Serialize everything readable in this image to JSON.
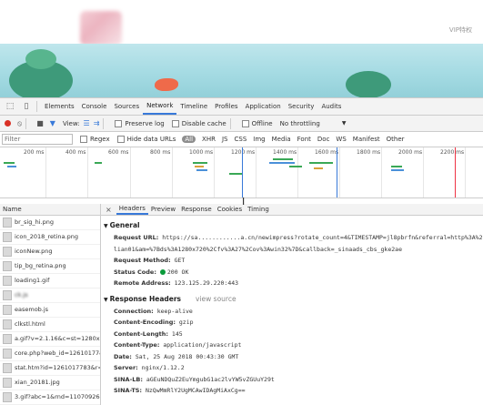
{
  "page": {
    "vip_link": "VIP特权"
  },
  "devtools": {
    "tabs": [
      "Elements",
      "Console",
      "Sources",
      "Network",
      "Timeline",
      "Profiles",
      "Application",
      "Security",
      "Audits"
    ],
    "active_tab": "Network",
    "toolbar": {
      "view_label": "View:",
      "preserve_log": "Preserve log",
      "disable_cache": "Disable cache",
      "offline": "Offline",
      "throttling": "No throttling"
    },
    "filterbar": {
      "filter_placeholder": "Filter",
      "regex": "Regex",
      "hide_data_urls": "Hide data URLs",
      "types": [
        "All",
        "XHR",
        "JS",
        "CSS",
        "Img",
        "Media",
        "Font",
        "Doc",
        "WS",
        "Manifest",
        "Other"
      ],
      "active_type": "All"
    },
    "timeline": {
      "ticks": [
        "200 ms",
        "400 ms",
        "600 ms",
        "800 ms",
        "1000 ms",
        "1200 ms",
        "1400 ms",
        "1600 ms",
        "1800 ms",
        "2000 ms",
        "2200 ms"
      ]
    },
    "requests": {
      "header": "Name",
      "items": [
        {
          "name": "br_sig_hi.png",
          "blur": false
        },
        {
          "name": "icon_2018_retina.png",
          "blur": false
        },
        {
          "name": "iconNew.png",
          "blur": false
        },
        {
          "name": "tip_bg_retina.png",
          "blur": false
        },
        {
          "name": "loading1.gif",
          "blur": false
        },
        {
          "name": "ck.js",
          "blur": true
        },
        {
          "name": "easemob.js",
          "blur": false
        },
        {
          "name": "clkstl.html",
          "blur": false
        },
        {
          "name": "a.gif?v=2.1.16&c=st=1280x7...",
          "blur": false
        },
        {
          "name": "core.php?web_id=12610177&...",
          "blur": false
        },
        {
          "name": "stat.htm?id=1261017783&r=...",
          "blur": false
        },
        {
          "name": "xian_20181.jpg",
          "blur": false
        },
        {
          "name": "3.gif?abc=1&rnd=1107092649",
          "blur": false
        },
        {
          "name": "newimpress?rotate_count=43...",
          "blur": false
        }
      ],
      "selected_index": 13
    },
    "detail": {
      "tabs": [
        "Headers",
        "Preview",
        "Response",
        "Cookies",
        "Timing"
      ],
      "active_tab": "Headers",
      "general_title": "General",
      "request_url_key": "Request URL:",
      "request_url_1": "https://sa............a.cn/newimpress?rotate_count=4&TIMESTAMP=jl8pbrfn&referral=http%3A%2F%2Fmail.",
      "request_url_2": "lian01&am=%7Bds%3A1280x720%2Cfv%3A27%2Cov%3Awin32%7D&callback=_sinaads_cbs_gke2ae",
      "request_method_key": "Request Method:",
      "request_method": "GET",
      "status_code_key": "Status Code:",
      "status_code": "200 OK",
      "remote_address_key": "Remote Address:",
      "remote_address": "123.125.29.220:443",
      "response_title": "Response Headers",
      "view_source": "view source",
      "headers": [
        {
          "k": "Connection:",
          "v": "keep-alive"
        },
        {
          "k": "Content-Encoding:",
          "v": "gzip"
        },
        {
          "k": "Content-Length:",
          "v": "145"
        },
        {
          "k": "Content-Type:",
          "v": "application/javascript"
        },
        {
          "k": "Date:",
          "v": "Sat, 25 Aug 2018 00:43:30 GMT"
        },
        {
          "k": "Server:",
          "v": "nginx/1.12.2"
        },
        {
          "k": "SINA-LB:",
          "v": "aGEuNDQuZ2EuYmgubG1ac2lvYW5vZGUuY29t"
        },
        {
          "k": "SINA-TS:",
          "v": "NzQwMmRlY2UgMCAwIDAgMiAxCg=="
        }
      ]
    }
  }
}
